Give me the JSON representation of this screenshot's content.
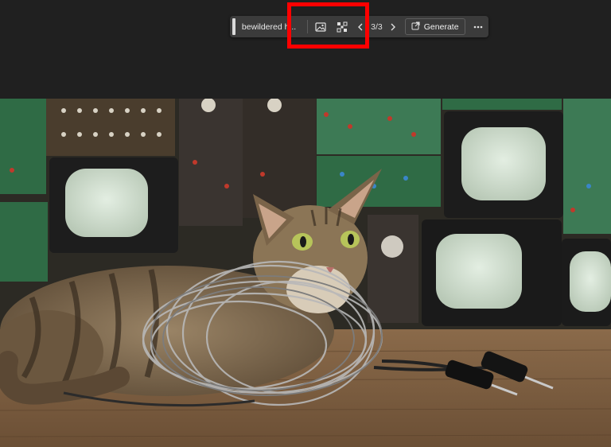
{
  "toolbar": {
    "prompt_text": "bewildered h...",
    "counter": "3/3",
    "generate_label": "Generate",
    "icons": [
      "image-icon",
      "remove-background-icon",
      "chevron-left-icon",
      "chevron-right-icon",
      "generate-icon",
      "more-icon"
    ]
  },
  "highlight": {
    "color": "#ff0000",
    "targets": [
      "image-icon",
      "remove-background-icon"
    ]
  },
  "image": {
    "subject": "tabby cat lying in a tangle of cables on a wooden table in front of vintage electronics and CRT monitors"
  }
}
